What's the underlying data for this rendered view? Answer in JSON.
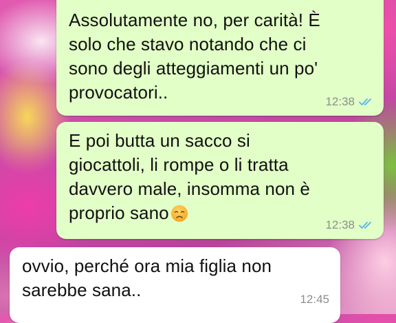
{
  "messages": [
    {
      "direction": "outgoing",
      "text": "Assolutamente no, per carità! È\nsolo che stavo notando che ci\nsono degli atteggiamenti un po'\nprovocatori..",
      "time": "12:38",
      "status": "read",
      "status_icon": "double-check-icon"
    },
    {
      "direction": "outgoing",
      "text": "E poi butta un sacco si\ngiocattoli, li rompe o li tratta\ndavvero male, insomma non è\nproprio sano",
      "emoji": "disappointed-face",
      "time": "12:38",
      "status": "read",
      "status_icon": "double-check-icon"
    },
    {
      "direction": "incoming",
      "text": "ovvio, perché ora mia figlia non\nsarebbe sana..",
      "time": "12:45"
    }
  ],
  "colors": {
    "outgoing_bubble": "#e2ffc7",
    "incoming_bubble": "#ffffff",
    "read_ticks": "#4fb6ec",
    "timestamp": "#8a8f8a"
  }
}
